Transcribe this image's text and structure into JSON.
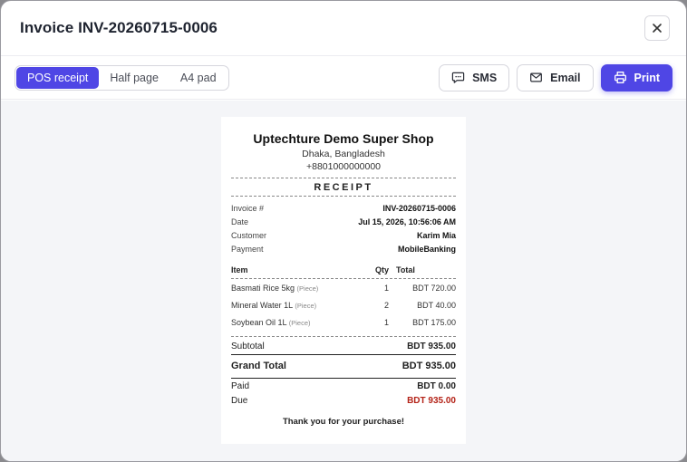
{
  "modal": {
    "title": "Invoice INV-20260715-0006"
  },
  "toolbar": {
    "formats": [
      {
        "label": "POS receipt",
        "active": true
      },
      {
        "label": "Half page",
        "active": false
      },
      {
        "label": "A4 pad",
        "active": false
      }
    ],
    "sms_label": "SMS",
    "email_label": "Email",
    "print_label": "Print"
  },
  "receipt": {
    "shop_name": "Uptechture Demo Super Shop",
    "address": "Dhaka, Bangladesh",
    "phone": "+8801000000000",
    "heading": "RECEIPT",
    "meta": [
      {
        "label": "Invoice #",
        "value": "INV-20260715-0006"
      },
      {
        "label": "Date",
        "value": "Jul 15, 2026, 10:56:06 AM"
      },
      {
        "label": "Customer",
        "value": "Karim Mia"
      },
      {
        "label": "Payment",
        "value": "MobileBanking"
      }
    ],
    "columns": {
      "item": "Item",
      "qty": "Qty",
      "total": "Total"
    },
    "items": [
      {
        "name": "Basmati Rice 5kg",
        "unit": "(Piece)",
        "qty": "1",
        "total": "BDT 720.00"
      },
      {
        "name": "Mineral Water 1L",
        "unit": "(Piece)",
        "qty": "2",
        "total": "BDT 40.00"
      },
      {
        "name": "Soybean Oil 1L",
        "unit": "(Piece)",
        "qty": "1",
        "total": "BDT 175.00"
      }
    ],
    "subtotal_label": "Subtotal",
    "subtotal_value": "BDT 935.00",
    "grand_total_label": "Grand Total",
    "grand_total_value": "BDT 935.00",
    "paid_label": "Paid",
    "paid_value": "BDT 0.00",
    "due_label": "Due",
    "due_value": "BDT 935.00",
    "thanks": "Thank you for your purchase!"
  },
  "colors": {
    "accent": "#4f46e5",
    "due": "#b42318"
  }
}
